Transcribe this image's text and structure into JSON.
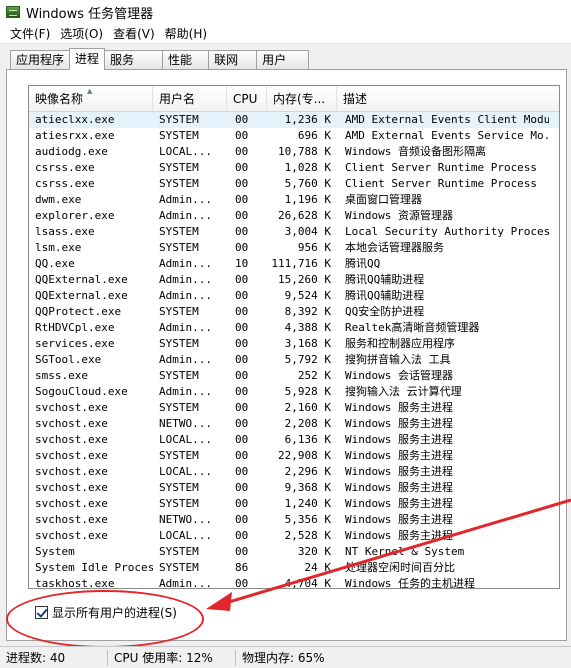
{
  "window": {
    "title": "Windows 任务管理器"
  },
  "menu": [
    {
      "label": "文件(F)"
    },
    {
      "label": "选项(O)"
    },
    {
      "label": "查看(V)"
    },
    {
      "label": "帮助(H)"
    }
  ],
  "tabs": [
    {
      "label": "应用程序",
      "active": false
    },
    {
      "label": "进程",
      "active": true
    },
    {
      "label": "服务",
      "active": false
    },
    {
      "label": "性能",
      "active": false
    },
    {
      "label": "联网",
      "active": false
    },
    {
      "label": "用户",
      "active": false
    }
  ],
  "columns": [
    {
      "label": "映像名称"
    },
    {
      "label": "用户名"
    },
    {
      "label": "CPU"
    },
    {
      "label": "内存(专..."
    },
    {
      "label": "描述"
    }
  ],
  "processes": [
    [
      "atieclxx.exe",
      "SYSTEM",
      "00",
      "1,236 K",
      "AMD External Events Client Module"
    ],
    [
      "atiesrxx.exe",
      "SYSTEM",
      "00",
      "696 K",
      "AMD External Events Service Mo..."
    ],
    [
      "audiodg.exe",
      "LOCAL...",
      "00",
      "10,788 K",
      "Windows 音频设备图形隔离"
    ],
    [
      "csrss.exe",
      "SYSTEM",
      "00",
      "1,028 K",
      "Client Server Runtime Process"
    ],
    [
      "csrss.exe",
      "SYSTEM",
      "00",
      "5,760 K",
      "Client Server Runtime Process"
    ],
    [
      "dwm.exe",
      "Admin...",
      "00",
      "1,196 K",
      "桌面窗口管理器"
    ],
    [
      "explorer.exe",
      "Admin...",
      "00",
      "26,628 K",
      "Windows 资源管理器"
    ],
    [
      "lsass.exe",
      "SYSTEM",
      "00",
      "3,004 K",
      "Local Security Authority Process"
    ],
    [
      "lsm.exe",
      "SYSTEM",
      "00",
      "956 K",
      "本地会话管理器服务"
    ],
    [
      "QQ.exe",
      "Admin...",
      "10",
      "111,716 K",
      "腾讯QQ"
    ],
    [
      "QQExternal.exe",
      "Admin...",
      "00",
      "15,260 K",
      "腾讯QQ辅助进程"
    ],
    [
      "QQExternal.exe",
      "Admin...",
      "00",
      "9,524 K",
      "腾讯QQ辅助进程"
    ],
    [
      "QQProtect.exe",
      "SYSTEM",
      "00",
      "8,392 K",
      "QQ安全防护进程"
    ],
    [
      "RtHDVCpl.exe",
      "Admin...",
      "00",
      "4,388 K",
      "Realtek高清晰音频管理器"
    ],
    [
      "services.exe",
      "SYSTEM",
      "00",
      "3,168 K",
      "服务和控制器应用程序"
    ],
    [
      "SGTool.exe",
      "Admin...",
      "00",
      "5,792 K",
      "搜狗拼音输入法 工具"
    ],
    [
      "smss.exe",
      "SYSTEM",
      "00",
      "252 K",
      "Windows 会话管理器"
    ],
    [
      "SogouCloud.exe",
      "Admin...",
      "00",
      "5,928 K",
      "搜狗输入法 云计算代理"
    ],
    [
      "svchost.exe",
      "SYSTEM",
      "00",
      "2,160 K",
      "Windows 服务主进程"
    ],
    [
      "svchost.exe",
      "NETWO...",
      "00",
      "2,208 K",
      "Windows 服务主进程"
    ],
    [
      "svchost.exe",
      "LOCAL...",
      "00",
      "6,136 K",
      "Windows 服务主进程"
    ],
    [
      "svchost.exe",
      "SYSTEM",
      "00",
      "22,908 K",
      "Windows 服务主进程"
    ],
    [
      "svchost.exe",
      "LOCAL...",
      "00",
      "2,296 K",
      "Windows 服务主进程"
    ],
    [
      "svchost.exe",
      "SYSTEM",
      "00",
      "9,368 K",
      "Windows 服务主进程"
    ],
    [
      "svchost.exe",
      "SYSTEM",
      "00",
      "1,240 K",
      "Windows 服务主进程"
    ],
    [
      "svchost.exe",
      "NETWO...",
      "00",
      "5,356 K",
      "Windows 服务主进程"
    ],
    [
      "svchost.exe",
      "LOCAL...",
      "00",
      "2,528 K",
      "Windows 服务主进程"
    ],
    [
      "System",
      "SYSTEM",
      "00",
      "320 K",
      "NT Kernel & System"
    ],
    [
      "System Idle Process",
      "SYSTEM",
      "86",
      "24 K",
      "处理器空闲时间百分比"
    ],
    [
      "taskhost.exe",
      "Admin...",
      "00",
      "4,704 K",
      "Windows 任务的主机进程"
    ]
  ],
  "show_all": {
    "label": "显示所有用户的进程(S)",
    "checked": true
  },
  "status": {
    "process_count": "进程数: 40",
    "cpu_usage": "CPU 使用率: 12%",
    "physical_memory": "物理内存: 65%"
  },
  "colors": {
    "annotation": "#e2262a",
    "selection": "#e5f1fb"
  }
}
